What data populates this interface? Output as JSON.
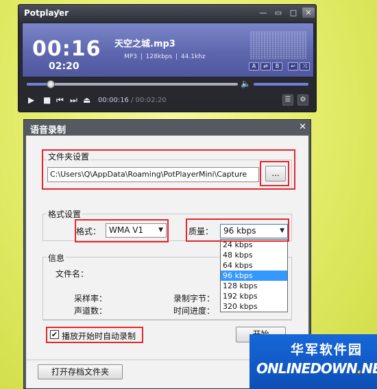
{
  "player": {
    "app_title": "Potplayer",
    "caret": "▾",
    "win_controls": {
      "minimize": "—",
      "restore": "▭",
      "maximize": "□",
      "close": "✕"
    },
    "elapsed_big": "00:16",
    "duration_small": "02:20",
    "track_title": "天空之城.mp3",
    "track_meta": "MP3 | 128kbps | 44.1khz",
    "display_buttons": [
      "A",
      "⇄",
      "B",
      "↩",
      "⤨"
    ],
    "seek_progress": 0.115,
    "volume_level": 1.0,
    "position_time": "00:00:16",
    "position_sep": "/",
    "total_time": "00:02:20",
    "icons": {
      "play": "▶",
      "stop": "■",
      "prev": "⏮",
      "next": "⏭",
      "eject": "⏏",
      "volume": "🔈",
      "playlist": "☰",
      "settings": "⚙"
    }
  },
  "dialog": {
    "title": "语音录制",
    "close": "✕",
    "folder_group": "文件夹设置",
    "folder_path": "C:\\Users\\Q\\AppData\\Roaming\\PotPlayerMini\\Capture",
    "browse_label": "...",
    "format_group": "格式设置",
    "format_label": "格式：",
    "format_value": "WMA V1",
    "quality_label": "质量：",
    "quality_value": "96 kbps",
    "select_arrow": "▼",
    "quality_options": [
      "24 kbps",
      "48 kbps",
      "64 kbps",
      "96 kbps",
      "128 kbps",
      "192 kbps",
      "320 kbps"
    ],
    "quality_selected_index": 3,
    "info_group": "信息",
    "filename_label": "文件名：",
    "samplerate_label": "采样率：",
    "channels_label": "声道数：",
    "bytes_label": "录制字节：",
    "progress_label": "时间进度：",
    "autorecord_checked": true,
    "autorecord_mark": "✔",
    "autorecord_label": "播放开始时自动录制",
    "start_button": "开始",
    "open_folder_button": "打开存档文件夹"
  },
  "watermark": {
    "cn": "华军软件园",
    "en_prefix": "ONLINEDOWN",
    "en_dot": ".",
    "en_suffix": "NET"
  },
  "colors": {
    "highlight": "#e3262c",
    "dropdown_selected": "#3399ff",
    "display_blue": "#5e67ae"
  }
}
